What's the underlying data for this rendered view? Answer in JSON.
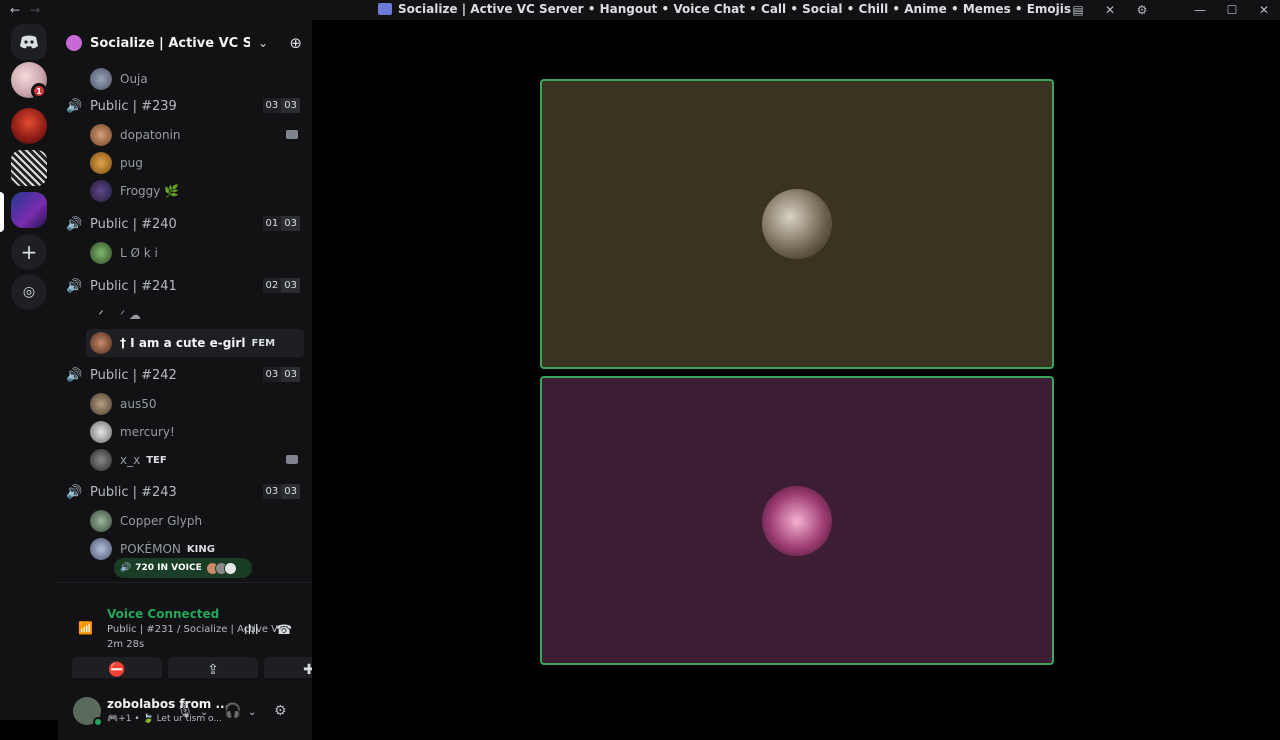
{
  "titlebar": {
    "back": "←",
    "forward": "→",
    "title": "Socialize | Active VC Server • Hangout • Voice Chat • Call • Social • Chill • Anime • Memes • Emojis",
    "minimize": "—",
    "maximize": "☐",
    "close": "✕"
  },
  "rail": {
    "badge_count": "1"
  },
  "server": {
    "name": "Socialize | Active VC Ser...",
    "chevron": "⌄",
    "invite_icon": "👤+"
  },
  "channels": [
    {
      "name": "Public | #239",
      "count_a": "03",
      "count_b": "03",
      "users": [
        {
          "name": "dopatonin",
          "camera": true
        },
        {
          "name": "pug"
        },
        {
          "name": "Froggy 🌿"
        }
      ]
    },
    {
      "name": "Public | #240",
      "count_a": "01",
      "count_b": "03",
      "users": [
        {
          "name": "L Ø k i"
        }
      ]
    },
    {
      "name": "Public | #241",
      "count_a": "02",
      "count_b": "03",
      "users": [
        {
          "name": "ᐟ ☁"
        },
        {
          "name": "† I am a cute e-girl",
          "tag": "FEM"
        }
      ]
    },
    {
      "name": "Public | #242",
      "count_a": "03",
      "count_b": "03",
      "users": [
        {
          "name": "aus50"
        },
        {
          "name": "mercury!"
        },
        {
          "name": "x_x",
          "tag": "TEF",
          "camera": true
        }
      ]
    },
    {
      "name": "Public | #243",
      "count_a": "03",
      "count_b": "03",
      "users": [
        {
          "name": "Copper Glyph"
        },
        {
          "name": "POKÉMON",
          "tag": "KING"
        }
      ]
    }
  ],
  "top_user": "Ouja",
  "vc_pill": "720 IN VOICE",
  "voice": {
    "status": "Voice Connected",
    "channel": "Public | #231 / Socialize | Active VC S...",
    "time": "2m  28s"
  },
  "user": {
    "name": "zobolabos from ...",
    "subtitle": "🎮+1 • 🍃 Let ur tism o..."
  }
}
